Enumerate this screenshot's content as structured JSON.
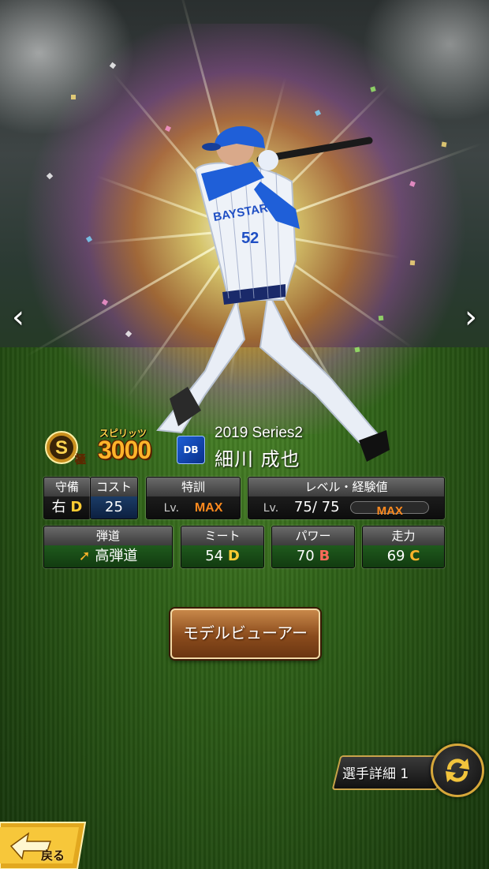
{
  "card": {
    "spirits_label": "スピリッツ",
    "spirits_value": "3000",
    "rank": "S",
    "rank_sub": "極",
    "team_logo": "DB",
    "series": "2019 Series2",
    "player_name": "細川 成也",
    "uniform_number": "52",
    "uniform_text": "BAYSTARS"
  },
  "stats": {
    "defense": {
      "label": "守備",
      "position": "右",
      "grade": "D"
    },
    "cost": {
      "label": "コスト",
      "value": "25"
    },
    "special_training": {
      "label": "特訓",
      "lv_prefix": "Lv.",
      "value": "MAX"
    },
    "level": {
      "label": "レベル・経験値",
      "lv_prefix": "Lv.",
      "value": "75/ 75",
      "exp": "MAX",
      "exp_fill": 1.0
    },
    "trajectory": {
      "label": "弾道",
      "value": "高弾道"
    },
    "meet": {
      "label": "ミート",
      "value": "54",
      "grade": "D"
    },
    "power": {
      "label": "パワー",
      "value": "70",
      "grade": "B"
    },
    "speed": {
      "label": "走力",
      "value": "69",
      "grade": "C"
    }
  },
  "buttons": {
    "model_viewer": "モデルビューアー",
    "player_detail": "選手詳細 1",
    "back": "戻る"
  },
  "icons": {
    "prev": "chevron-left-icon",
    "next": "chevron-right-icon",
    "swap": "swap-arrows-icon",
    "back": "back-arrow-icon",
    "trajectory": "arrow-up-right-icon"
  },
  "colors": {
    "accent_gold": "#d6a73a",
    "spirits_orange": "#ffb42a",
    "max_orange": "#ff8a1e",
    "grade_d": "#ffcc33",
    "grade_b": "#ff6a5a",
    "grade_c": "#ffb42a"
  }
}
